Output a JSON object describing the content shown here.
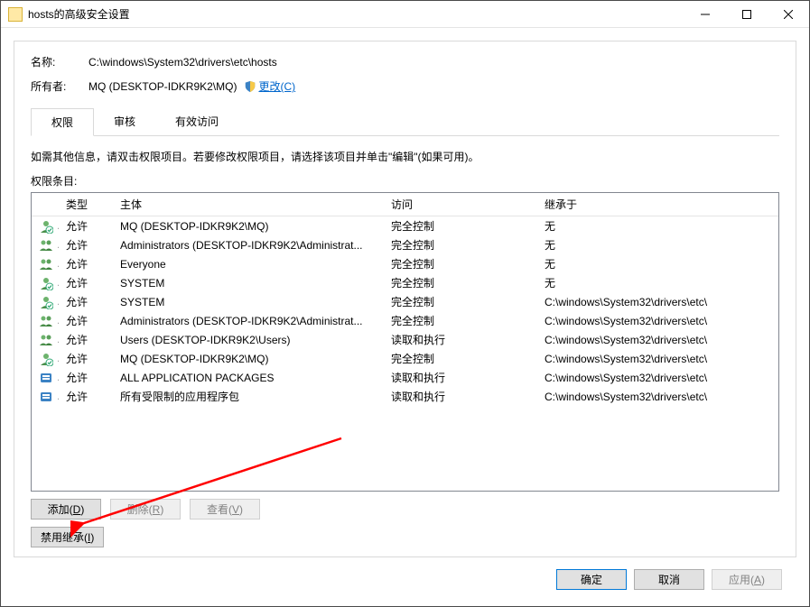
{
  "window": {
    "title": "hosts的高级安全设置"
  },
  "header": {
    "name_label": "名称:",
    "name_value": "C:\\windows\\System32\\drivers\\etc\\hosts",
    "owner_label": "所有者:",
    "owner_value": "MQ (DESKTOP-IDKR9K2\\MQ)",
    "change_link": "更改(C)"
  },
  "tabs": {
    "permissions": "权限",
    "audit": "审核",
    "effective": "有效访问"
  },
  "info_text": "如需其他信息，请双击权限项目。若要修改权限项目，请选择该项目并单击\"编辑\"(如果可用)。",
  "list_label": "权限条目:",
  "columns": {
    "type": "类型",
    "principal": "主体",
    "access": "访问",
    "inherited_from": "继承于"
  },
  "entries": [
    {
      "icon": "user",
      "type": "允许",
      "principal": "MQ (DESKTOP-IDKR9K2\\MQ)",
      "access": "完全控制",
      "inherited": "无"
    },
    {
      "icon": "group",
      "type": "允许",
      "principal": "Administrators (DESKTOP-IDKR9K2\\Administrat...",
      "access": "完全控制",
      "inherited": "无"
    },
    {
      "icon": "group",
      "type": "允许",
      "principal": "Everyone",
      "access": "完全控制",
      "inherited": "无"
    },
    {
      "icon": "user",
      "type": "允许",
      "principal": "SYSTEM",
      "access": "完全控制",
      "inherited": "无"
    },
    {
      "icon": "user",
      "type": "允许",
      "principal": "SYSTEM",
      "access": "完全控制",
      "inherited": "C:\\windows\\System32\\drivers\\etc\\"
    },
    {
      "icon": "group",
      "type": "允许",
      "principal": "Administrators (DESKTOP-IDKR9K2\\Administrat...",
      "access": "完全控制",
      "inherited": "C:\\windows\\System32\\drivers\\etc\\"
    },
    {
      "icon": "group",
      "type": "允许",
      "principal": "Users (DESKTOP-IDKR9K2\\Users)",
      "access": "读取和执行",
      "inherited": "C:\\windows\\System32\\drivers\\etc\\"
    },
    {
      "icon": "user",
      "type": "允许",
      "principal": "MQ (DESKTOP-IDKR9K2\\MQ)",
      "access": "完全控制",
      "inherited": "C:\\windows\\System32\\drivers\\etc\\"
    },
    {
      "icon": "package",
      "type": "允许",
      "principal": "ALL APPLICATION PACKAGES",
      "access": "读取和执行",
      "inherited": "C:\\windows\\System32\\drivers\\etc\\"
    },
    {
      "icon": "package",
      "type": "允许",
      "principal": "所有受限制的应用程序包",
      "access": "读取和执行",
      "inherited": "C:\\windows\\System32\\drivers\\etc\\"
    }
  ],
  "buttons": {
    "add": "添加(D)",
    "remove": "删除(R)",
    "view": "查看(V)",
    "disable_inherit": "禁用继承(I)",
    "ok": "确定",
    "cancel": "取消",
    "apply": "应用(A)"
  }
}
